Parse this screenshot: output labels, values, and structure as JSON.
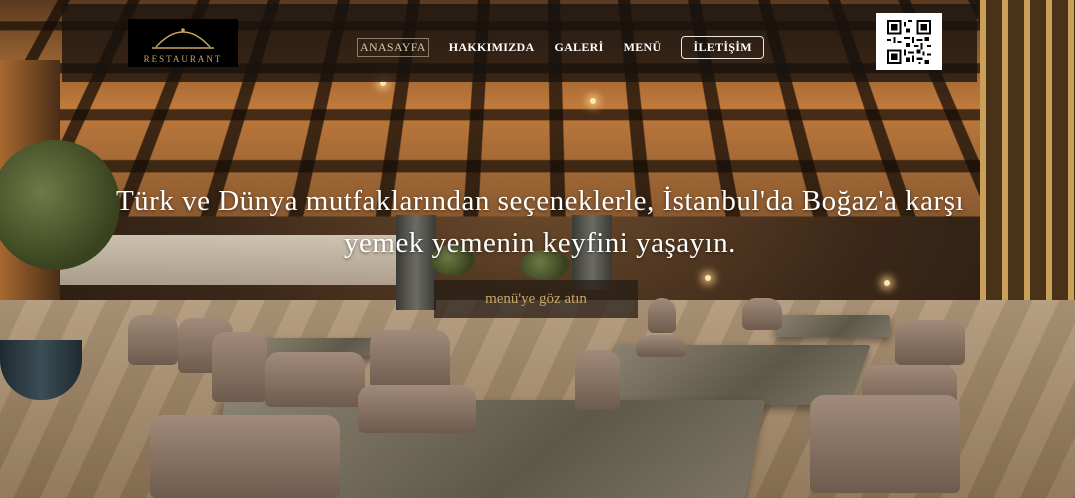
{
  "logo": {
    "text": "RESTAURANT"
  },
  "nav": {
    "items": [
      {
        "label": "ANASAYFA"
      },
      {
        "label": "HAKKIMIZDA"
      },
      {
        "label": "GALERİ"
      },
      {
        "label": "MENÜ"
      },
      {
        "label": "İLETİŞİM"
      }
    ]
  },
  "hero": {
    "headline": "Türk ve Dünya mutfaklarından seçeneklerle, İstanbul'da Boğaz'a karşı yemek yemenin keyfini yaşayın.",
    "cta_label": "menü'ye göz atın"
  },
  "icons": {
    "qr": "qr-code-icon",
    "logo_mark": "cloche-icon"
  },
  "colors": {
    "accent_gold": "#c9a55c",
    "header_bg": "#18120e"
  }
}
